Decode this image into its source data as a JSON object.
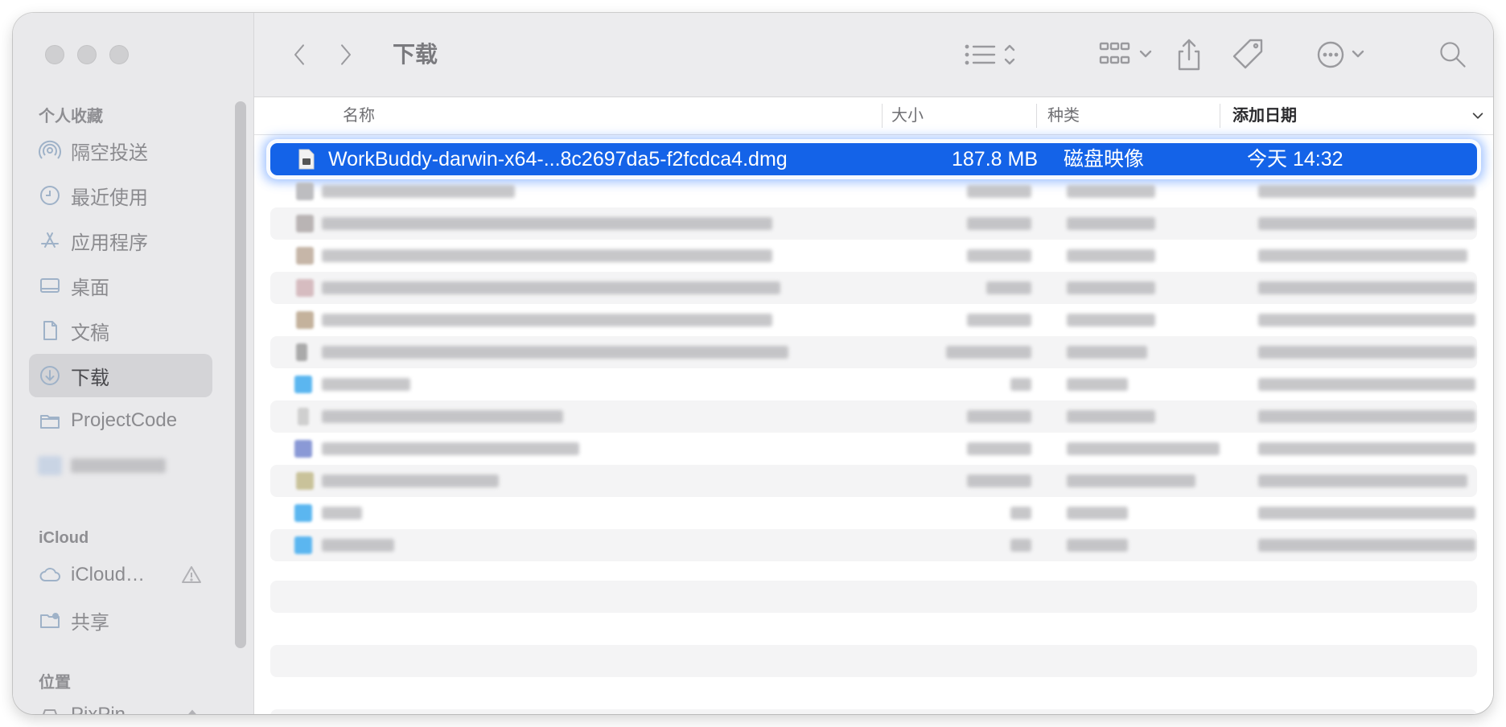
{
  "toolbar": {
    "title": "下载",
    "icons": [
      "chevron-left-icon",
      "chevron-right-icon",
      "list-view-icon",
      "grid-view-icon",
      "share-icon",
      "tag-icon",
      "more-icon",
      "search-icon"
    ]
  },
  "sidebar": {
    "favorites_title": "个人收藏",
    "favorites": [
      {
        "label": "隔空投送",
        "icon": "airdrop-icon"
      },
      {
        "label": "最近使用",
        "icon": "clock-icon"
      },
      {
        "label": "应用程序",
        "icon": "apps-icon"
      },
      {
        "label": "桌面",
        "icon": "desktop-icon"
      },
      {
        "label": "文稿",
        "icon": "document-icon"
      },
      {
        "label": "下载",
        "icon": "download-icon",
        "active": true
      },
      {
        "label": "ProjectCode",
        "icon": "folder-icon"
      }
    ],
    "icloud_title": "iCloud",
    "icloud": [
      {
        "label": "iCloud…",
        "icon": "cloud-icon"
      },
      {
        "label": "共享",
        "icon": "shared-folder-icon"
      }
    ],
    "locations_title": "位置",
    "locations": [
      {
        "label": "PixPin",
        "icon": "drive-icon"
      }
    ]
  },
  "columns": {
    "name": "名称",
    "size": "大小",
    "kind": "种类",
    "date": "添加日期"
  },
  "selected_file": {
    "name": "WorkBuddy-darwin-x64-...8c2697da5-f2fcdca4.dmg",
    "size": "187.8 MB",
    "kind": "磁盘映像",
    "date": "今天 14:32"
  },
  "colors": {
    "selection": "#1463e8",
    "sidebar": "#e9e9eb",
    "toolbar": "#ececee"
  }
}
